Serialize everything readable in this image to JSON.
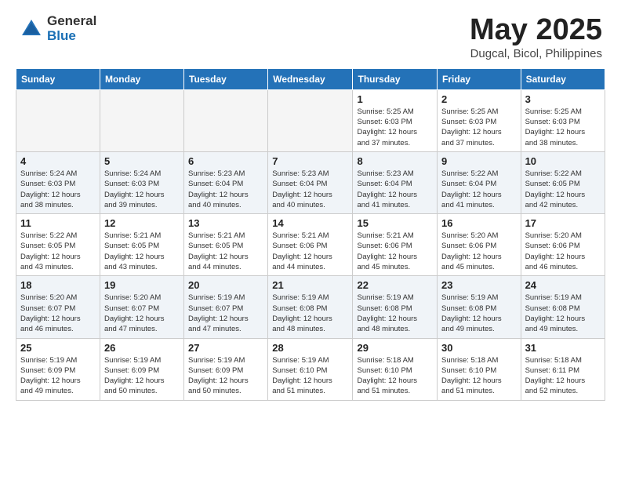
{
  "header": {
    "logo_general": "General",
    "logo_blue": "Blue",
    "month": "May 2025",
    "location": "Dugcal, Bicol, Philippines"
  },
  "weekdays": [
    "Sunday",
    "Monday",
    "Tuesday",
    "Wednesday",
    "Thursday",
    "Friday",
    "Saturday"
  ],
  "weeks": [
    [
      {
        "day": "",
        "info": ""
      },
      {
        "day": "",
        "info": ""
      },
      {
        "day": "",
        "info": ""
      },
      {
        "day": "",
        "info": ""
      },
      {
        "day": "1",
        "info": "Sunrise: 5:25 AM\nSunset: 6:03 PM\nDaylight: 12 hours\nand 37 minutes."
      },
      {
        "day": "2",
        "info": "Sunrise: 5:25 AM\nSunset: 6:03 PM\nDaylight: 12 hours\nand 37 minutes."
      },
      {
        "day": "3",
        "info": "Sunrise: 5:25 AM\nSunset: 6:03 PM\nDaylight: 12 hours\nand 38 minutes."
      }
    ],
    [
      {
        "day": "4",
        "info": "Sunrise: 5:24 AM\nSunset: 6:03 PM\nDaylight: 12 hours\nand 38 minutes."
      },
      {
        "day": "5",
        "info": "Sunrise: 5:24 AM\nSunset: 6:03 PM\nDaylight: 12 hours\nand 39 minutes."
      },
      {
        "day": "6",
        "info": "Sunrise: 5:23 AM\nSunset: 6:04 PM\nDaylight: 12 hours\nand 40 minutes."
      },
      {
        "day": "7",
        "info": "Sunrise: 5:23 AM\nSunset: 6:04 PM\nDaylight: 12 hours\nand 40 minutes."
      },
      {
        "day": "8",
        "info": "Sunrise: 5:23 AM\nSunset: 6:04 PM\nDaylight: 12 hours\nand 41 minutes."
      },
      {
        "day": "9",
        "info": "Sunrise: 5:22 AM\nSunset: 6:04 PM\nDaylight: 12 hours\nand 41 minutes."
      },
      {
        "day": "10",
        "info": "Sunrise: 5:22 AM\nSunset: 6:05 PM\nDaylight: 12 hours\nand 42 minutes."
      }
    ],
    [
      {
        "day": "11",
        "info": "Sunrise: 5:22 AM\nSunset: 6:05 PM\nDaylight: 12 hours\nand 43 minutes."
      },
      {
        "day": "12",
        "info": "Sunrise: 5:21 AM\nSunset: 6:05 PM\nDaylight: 12 hours\nand 43 minutes."
      },
      {
        "day": "13",
        "info": "Sunrise: 5:21 AM\nSunset: 6:05 PM\nDaylight: 12 hours\nand 44 minutes."
      },
      {
        "day": "14",
        "info": "Sunrise: 5:21 AM\nSunset: 6:06 PM\nDaylight: 12 hours\nand 44 minutes."
      },
      {
        "day": "15",
        "info": "Sunrise: 5:21 AM\nSunset: 6:06 PM\nDaylight: 12 hours\nand 45 minutes."
      },
      {
        "day": "16",
        "info": "Sunrise: 5:20 AM\nSunset: 6:06 PM\nDaylight: 12 hours\nand 45 minutes."
      },
      {
        "day": "17",
        "info": "Sunrise: 5:20 AM\nSunset: 6:06 PM\nDaylight: 12 hours\nand 46 minutes."
      }
    ],
    [
      {
        "day": "18",
        "info": "Sunrise: 5:20 AM\nSunset: 6:07 PM\nDaylight: 12 hours\nand 46 minutes."
      },
      {
        "day": "19",
        "info": "Sunrise: 5:20 AM\nSunset: 6:07 PM\nDaylight: 12 hours\nand 47 minutes."
      },
      {
        "day": "20",
        "info": "Sunrise: 5:19 AM\nSunset: 6:07 PM\nDaylight: 12 hours\nand 47 minutes."
      },
      {
        "day": "21",
        "info": "Sunrise: 5:19 AM\nSunset: 6:08 PM\nDaylight: 12 hours\nand 48 minutes."
      },
      {
        "day": "22",
        "info": "Sunrise: 5:19 AM\nSunset: 6:08 PM\nDaylight: 12 hours\nand 48 minutes."
      },
      {
        "day": "23",
        "info": "Sunrise: 5:19 AM\nSunset: 6:08 PM\nDaylight: 12 hours\nand 49 minutes."
      },
      {
        "day": "24",
        "info": "Sunrise: 5:19 AM\nSunset: 6:08 PM\nDaylight: 12 hours\nand 49 minutes."
      }
    ],
    [
      {
        "day": "25",
        "info": "Sunrise: 5:19 AM\nSunset: 6:09 PM\nDaylight: 12 hours\nand 49 minutes."
      },
      {
        "day": "26",
        "info": "Sunrise: 5:19 AM\nSunset: 6:09 PM\nDaylight: 12 hours\nand 50 minutes."
      },
      {
        "day": "27",
        "info": "Sunrise: 5:19 AM\nSunset: 6:09 PM\nDaylight: 12 hours\nand 50 minutes."
      },
      {
        "day": "28",
        "info": "Sunrise: 5:19 AM\nSunset: 6:10 PM\nDaylight: 12 hours\nand 51 minutes."
      },
      {
        "day": "29",
        "info": "Sunrise: 5:18 AM\nSunset: 6:10 PM\nDaylight: 12 hours\nand 51 minutes."
      },
      {
        "day": "30",
        "info": "Sunrise: 5:18 AM\nSunset: 6:10 PM\nDaylight: 12 hours\nand 51 minutes."
      },
      {
        "day": "31",
        "info": "Sunrise: 5:18 AM\nSunset: 6:11 PM\nDaylight: 12 hours\nand 52 minutes."
      }
    ]
  ]
}
